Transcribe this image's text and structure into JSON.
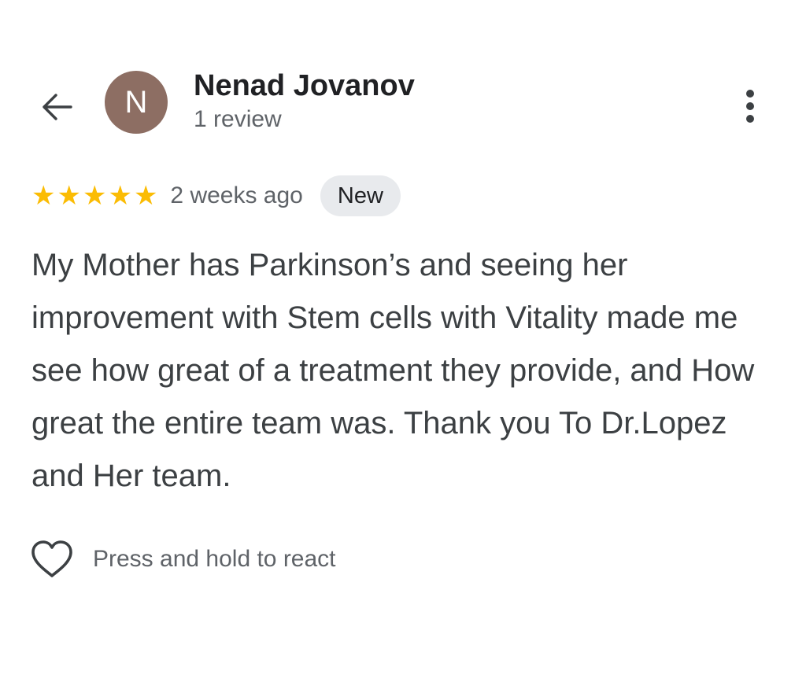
{
  "reviewer": {
    "initial": "N",
    "name": "Nenad Jovanov",
    "review_count": "1 review",
    "avatar_color": "#8d6e63"
  },
  "icons": {
    "back": "arrow-left-icon",
    "more": "more-vertical-icon",
    "star": "star-icon",
    "react": "heart-outline-icon"
  },
  "review": {
    "rating": 5,
    "max_rating": 5,
    "time": "2 weeks ago",
    "badge": "New",
    "text": "My Mother has Parkinson’s and seeing her improvement with Stem cells with Vitality made me see how great of a treatment they provide, and How great the entire team was. Thank you To Dr.Lopez and Her team."
  },
  "reaction": {
    "label": "Press and hold to react"
  },
  "colors": {
    "star": "#fbbc04",
    "badge_bg": "#e8eaed"
  }
}
